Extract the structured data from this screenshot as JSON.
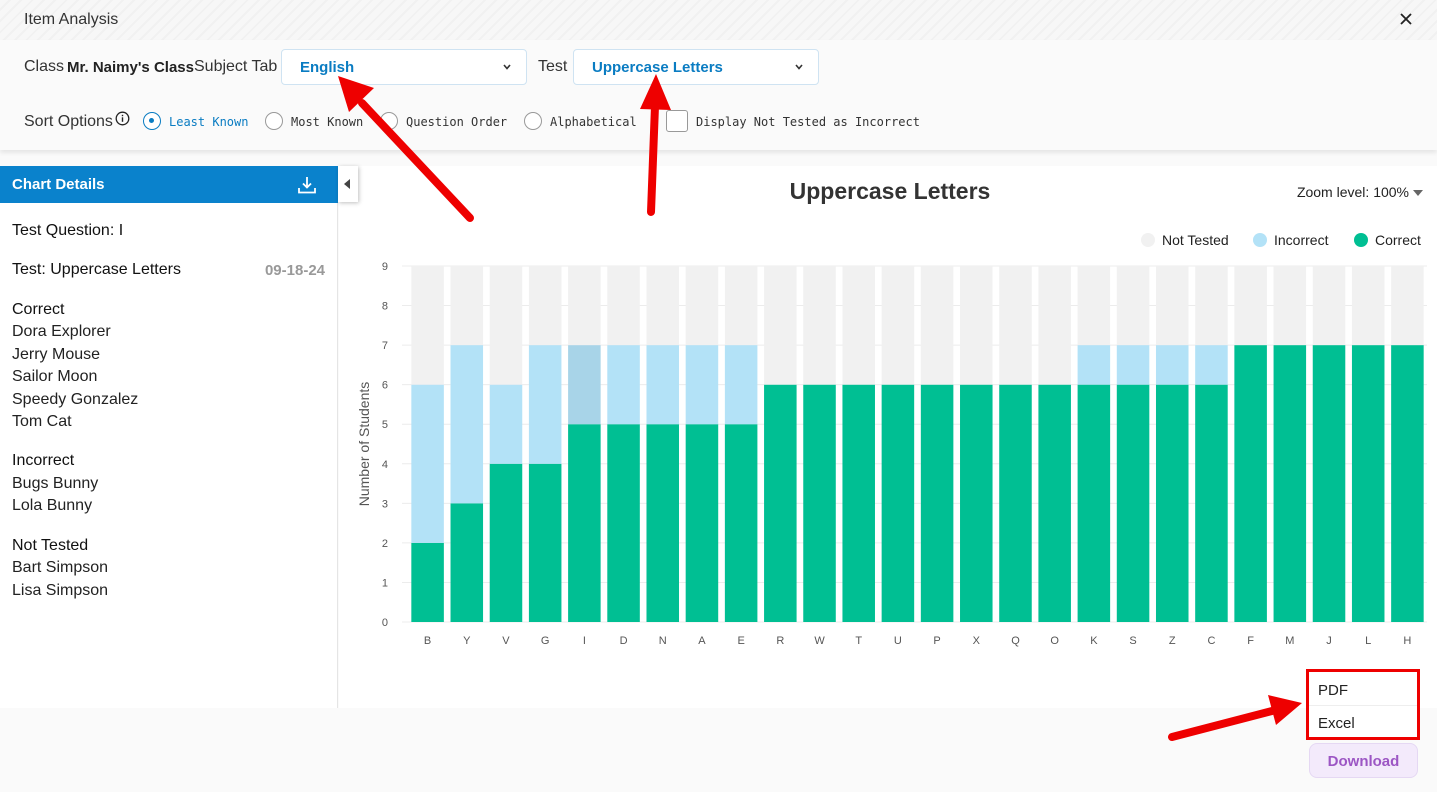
{
  "window": {
    "title": "Item Analysis"
  },
  "filters": {
    "class_label": "Class",
    "class_value": "Mr. Naimy's Class",
    "subject_label": "Subject Tab",
    "subject_value": "English",
    "test_label": "Test",
    "test_value": "Uppercase Letters",
    "sort_label": "Sort Options",
    "sort_options": [
      "Least Known",
      "Most Known",
      "Question Order",
      "Alphabetical"
    ],
    "sort_selected": "Least Known",
    "display_not_tested_label": "Display Not Tested as Incorrect"
  },
  "sidebar": {
    "header": "Chart Details",
    "test_question": "Test Question: I",
    "test_name": "Test: Uppercase Letters",
    "test_date": "09-18-24",
    "correct_heading": "Correct",
    "correct": [
      "Dora Explorer",
      "Jerry Mouse",
      "Sailor Moon",
      "Speedy Gonzalez",
      "Tom Cat"
    ],
    "incorrect_heading": "Incorrect",
    "incorrect": [
      "Bugs Bunny",
      "Lola Bunny"
    ],
    "not_tested_heading": "Not Tested",
    "not_tested": [
      "Bart Simpson",
      "Lisa Simpson"
    ]
  },
  "zoom": {
    "label": "Zoom level:",
    "value": "100%"
  },
  "export_menu": {
    "pdf": "PDF",
    "excel": "Excel",
    "download": "Download"
  },
  "colors": {
    "correct": "#00bf93",
    "incorrect": "#b3e2f7",
    "not_tested": "#f1f1f1",
    "highlight_incorrect": "#a8d4e8",
    "accent": "#0a82cc"
  },
  "chart_data": {
    "type": "bar",
    "stacked": true,
    "title": "Uppercase Letters",
    "ylabel": "Number of Students",
    "xlabel": "",
    "ylim": [
      0,
      9
    ],
    "yticks": [
      0,
      1,
      2,
      3,
      4,
      5,
      6,
      7,
      8,
      9
    ],
    "legend_position": "top-right",
    "categories": [
      "B",
      "Y",
      "V",
      "G",
      "I",
      "D",
      "N",
      "A",
      "E",
      "R",
      "W",
      "T",
      "U",
      "P",
      "X",
      "Q",
      "O",
      "K",
      "S",
      "Z",
      "C",
      "F",
      "M",
      "J",
      "L",
      "H"
    ],
    "series": [
      {
        "name": "Correct",
        "values": [
          2,
          3,
          4,
          4,
          5,
          5,
          5,
          5,
          5,
          6,
          6,
          6,
          6,
          6,
          6,
          6,
          6,
          6,
          6,
          6,
          6,
          7,
          7,
          7,
          7,
          7
        ]
      },
      {
        "name": "Incorrect",
        "values": [
          4,
          4,
          2,
          3,
          2,
          2,
          2,
          2,
          2,
          0,
          0,
          0,
          0,
          0,
          0,
          0,
          0,
          1,
          1,
          1,
          1,
          0,
          0,
          0,
          0,
          0
        ]
      },
      {
        "name": "Not Tested",
        "values": [
          3,
          2,
          3,
          2,
          2,
          2,
          2,
          2,
          2,
          3,
          3,
          3,
          3,
          3,
          3,
          3,
          3,
          2,
          2,
          2,
          2,
          2,
          2,
          2,
          2,
          2
        ]
      }
    ],
    "legend_order": [
      "Not Tested",
      "Incorrect",
      "Correct"
    ],
    "selected_category": "I"
  }
}
